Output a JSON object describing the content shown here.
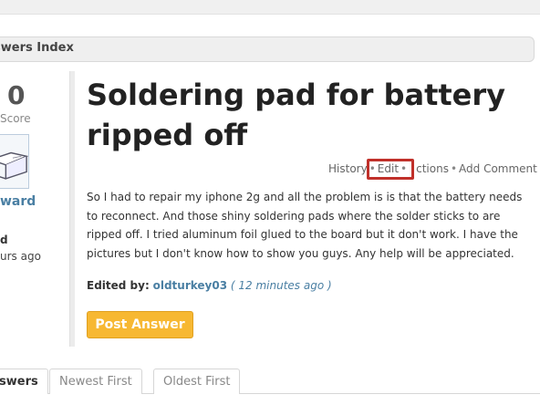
{
  "breadcrumb": {
    "label": "swers Index"
  },
  "vote": {
    "count": "0",
    "label": "Score"
  },
  "author": {
    "name": "ward",
    "asked_label": "d",
    "asked_time": "urs ago"
  },
  "question": {
    "title": "Soldering pad for battery ripped off",
    "body": "So I had to repair my iphone 2g and all the problem is is that the battery needs to reconnect. And those shiny soldering pads where the solder sticks to are ripped off. I tried aluminum foil glued to the board but it don't work. I have the pictures but I don't know how to show you guys. Any help will be appreciated.",
    "edited_label": "Edited by:",
    "edited_user": "oldturkey03",
    "edited_ago": "( 12 minutes ago )"
  },
  "actions": {
    "history": "History",
    "edit": "Edit",
    "actions": "ctions",
    "add_comment": "Add Comment",
    "separator": "•"
  },
  "post_answer": {
    "label": "Post Answer"
  },
  "tabs": [
    {
      "label": "swers",
      "active": true
    },
    {
      "label": "Newest First",
      "active": false
    },
    {
      "label": "Oldest First",
      "active": false
    }
  ],
  "colors": {
    "accent_button": "#f7b832",
    "link": "#4a7fa3",
    "highlight": "#c0302a"
  }
}
